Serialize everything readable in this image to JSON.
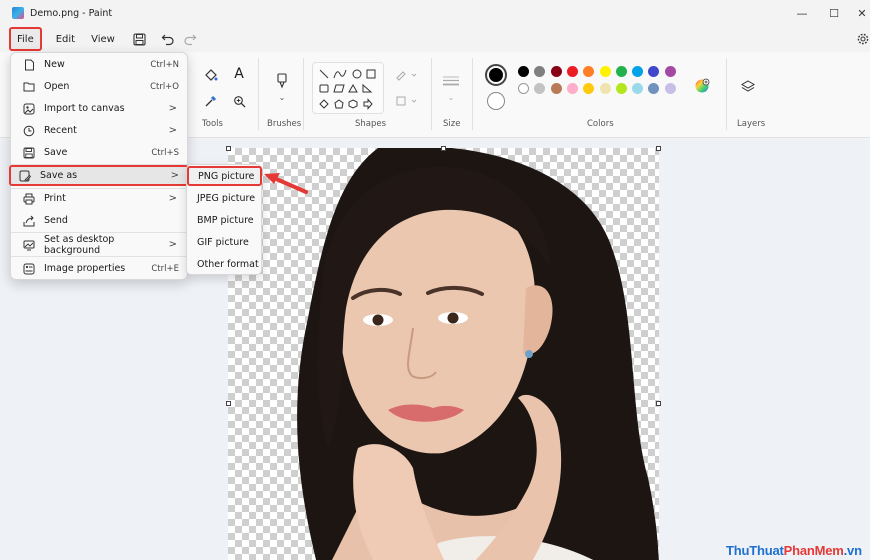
{
  "window": {
    "title": "Demo.png - Paint",
    "controls": {
      "minimize": "—",
      "maximize": "☐",
      "close": "✕"
    }
  },
  "menubar": {
    "file": "File",
    "edit": "Edit",
    "view": "View"
  },
  "ribbon": {
    "groups": {
      "tools": "Tools",
      "brushes": "Brushes",
      "shapes": "Shapes",
      "size": "Size",
      "colors": "Colors",
      "layers": "Layers"
    },
    "palette_row1": [
      "#000000",
      "#7f7f7f",
      "#880015",
      "#ed1c24",
      "#ff7f27",
      "#fff200",
      "#22b14c",
      "#00a2e8",
      "#3f48cc",
      "#a349a4"
    ],
    "palette_row2": [
      "#ffffff",
      "#c3c3c3",
      "#b97a57",
      "#ffaec9",
      "#ffc90e",
      "#efe4b0",
      "#b5e61d",
      "#99d9ea",
      "#7092be",
      "#c8bfe7"
    ],
    "current_color1": "#000000",
    "current_color2": "#ffffff"
  },
  "file_menu": {
    "items": [
      {
        "label": "New",
        "shortcut": "Ctrl+N",
        "icon": "new-file-icon"
      },
      {
        "label": "Open",
        "shortcut": "Ctrl+O",
        "icon": "folder-icon"
      },
      {
        "label": "Import to canvas",
        "shortcut": ">",
        "icon": "import-icon"
      },
      {
        "label": "Recent",
        "shortcut": ">",
        "icon": "clock-icon"
      },
      {
        "label": "Save",
        "shortcut": "Ctrl+S",
        "icon": "save-icon"
      },
      {
        "label": "Save as",
        "shortcut": ">",
        "icon": "save-as-icon"
      },
      {
        "label": "Print",
        "shortcut": ">",
        "icon": "print-icon"
      },
      {
        "label": "Send",
        "shortcut": "",
        "icon": "share-icon"
      },
      {
        "label": "Set as desktop background",
        "shortcut": ">",
        "icon": "desktop-icon"
      },
      {
        "label": "Image properties",
        "shortcut": "Ctrl+E",
        "icon": "properties-icon"
      }
    ]
  },
  "save_as_submenu": {
    "items": [
      "PNG picture",
      "JPEG picture",
      "BMP picture",
      "GIF picture",
      "Other format"
    ]
  },
  "watermark": {
    "part1": "ThuThuat",
    "part2": "PhanMem",
    "part3": ".vn"
  }
}
